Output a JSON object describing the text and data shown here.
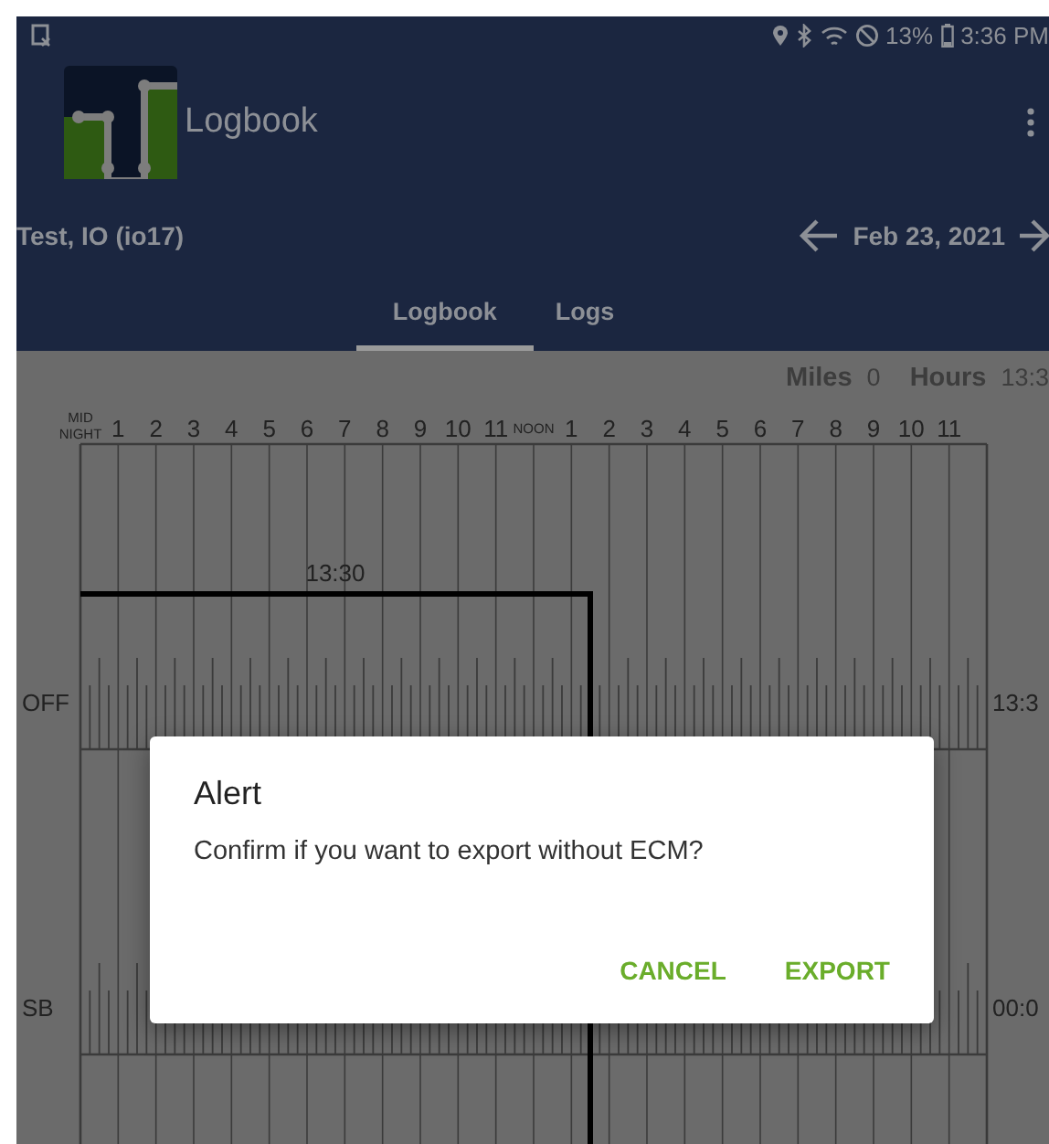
{
  "status_bar": {
    "battery": "13%",
    "time": "3:36 PM"
  },
  "app_bar": {
    "title": "Logbook"
  },
  "driver": "Test, IO (io17)",
  "date": "Feb 23, 2021",
  "tabs": [
    {
      "label": "Logbook",
      "selected": true
    },
    {
      "label": "Logs",
      "selected": false
    }
  ],
  "summary": [
    {
      "label": "Miles",
      "value": "0"
    },
    {
      "label": "Hours",
      "value": "13:3"
    }
  ],
  "graph": {
    "hour_labels": [
      "MID NIGHT",
      "1",
      "2",
      "3",
      "4",
      "5",
      "6",
      "7",
      "8",
      "9",
      "10",
      "11",
      "NOON",
      "1",
      "2",
      "3",
      "4",
      "5",
      "6",
      "7",
      "8",
      "9",
      "10",
      "11"
    ],
    "rows": [
      {
        "label": "OFF",
        "total": "13:3"
      },
      {
        "label": "SB",
        "total": "00:0"
      }
    ],
    "duration_label": "13:30"
  },
  "dialog": {
    "title": "Alert",
    "message": "Confirm if you want to export without ECM?",
    "buttons": [
      "CANCEL",
      "EXPORT"
    ]
  }
}
